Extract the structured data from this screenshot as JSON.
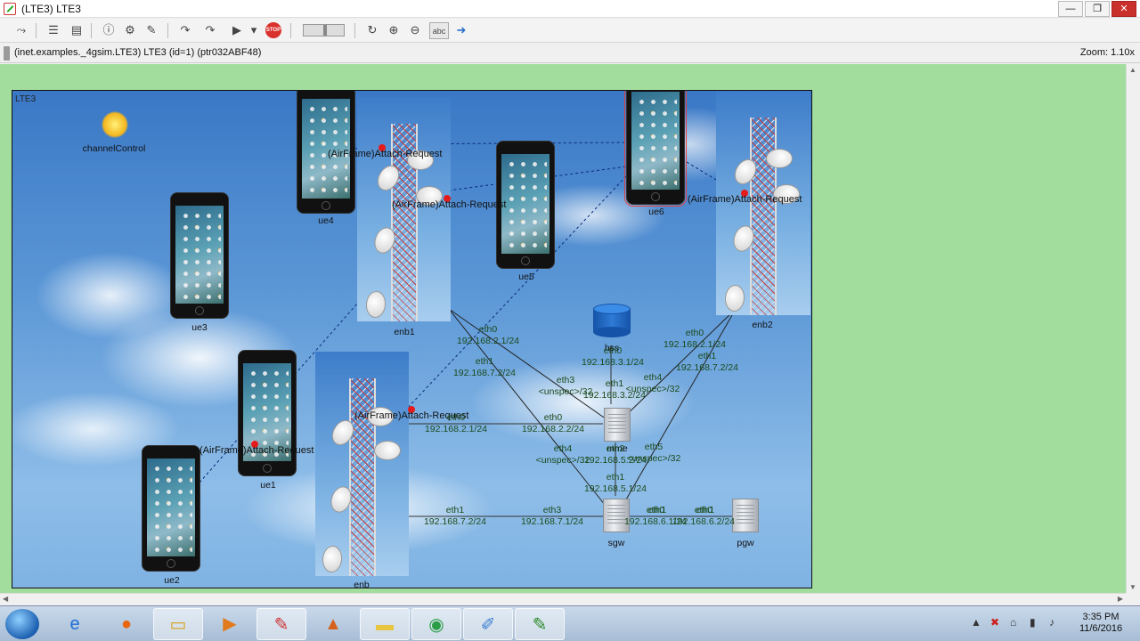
{
  "window": {
    "title": "(LTE3) LTE3",
    "min": "—",
    "max": "❐",
    "close": "✕"
  },
  "toolbar": {
    "icons": [
      "rebuild-icon",
      "list-icon",
      "inspector-icon",
      "info-icon",
      "settings-icon",
      "tools-icon",
      "step-icon",
      "fast-run-icon",
      "run-icon",
      "dropdown-icon",
      "stop-icon",
      "speed-slider",
      "refresh-icon",
      "zoom-in-icon",
      "zoom-out-icon",
      "label-toggle-icon",
      "arrow-icon"
    ],
    "stop_label": "STOP",
    "label_toggle": "abc"
  },
  "pathbar": {
    "path": "(inet.examples._4gsim.LTE3) LTE3  (id=1)  (ptr032ABF48)",
    "zoom": "Zoom: 1.10x"
  },
  "network": {
    "name": "LTE3",
    "nodes": {
      "channelControl": "channelControl",
      "ue1": "ue1",
      "ue2": "ue2",
      "ue3": "ue3",
      "ue4": "ue4",
      "ue5": "ue5",
      "ue6": "ue6",
      "enb": "enb",
      "enb1": "enb1",
      "enb2": "enb2",
      "hss": "hss",
      "mme": "mme",
      "sgw": "sgw",
      "pgw": "pgw"
    },
    "airframes": [
      "(AirFrame)Attach-Request",
      "(AirFrame)Attach-Request",
      "(AirFrame)Attach-Request",
      "(AirFrame)Attach-Request",
      "(AirFrame)Attach-Request"
    ],
    "links": [
      "eth0",
      "192.168.2.1/24",
      "eth1",
      "192.168.7.2/24",
      "eth3",
      "<unspec>/32",
      "eth1",
      "192.168.3.2/24",
      "eth0",
      "192.168.3.1/24",
      "eth4",
      "<unspec>/32",
      "eth0",
      "192.168.2.1/24",
      "eth1",
      "192.168.7.2/24",
      "eth0",
      "192.168.2.1/24",
      "eth0",
      "192.168.2.2/24",
      "eth4",
      "<unspec>/32",
      "eth2",
      "192.168.5.2/24",
      "eth5",
      "<unspec>/32",
      "eth1",
      "192.168.5.1/24",
      "eth1",
      "192.168.7.2/24",
      "eth3",
      "192.168.7.1/24",
      "eth0",
      "192.168.6.1/24",
      "eth0",
      "192.168.6.2/24",
      "eth1",
      "eth1"
    ]
  },
  "taskbar": {
    "apps": [
      "ie-icon",
      "firefox-icon",
      "explorer-icon",
      "media-icon",
      "omnetpp-icon",
      "matlab-icon",
      "folder-icon",
      "chrome-icon",
      "paint-icon",
      "tkenv-icon"
    ],
    "time": "3:35 PM",
    "date": "11/6/2016",
    "tray": [
      "▲",
      "✖",
      "⌂",
      "▮",
      "♪"
    ]
  }
}
